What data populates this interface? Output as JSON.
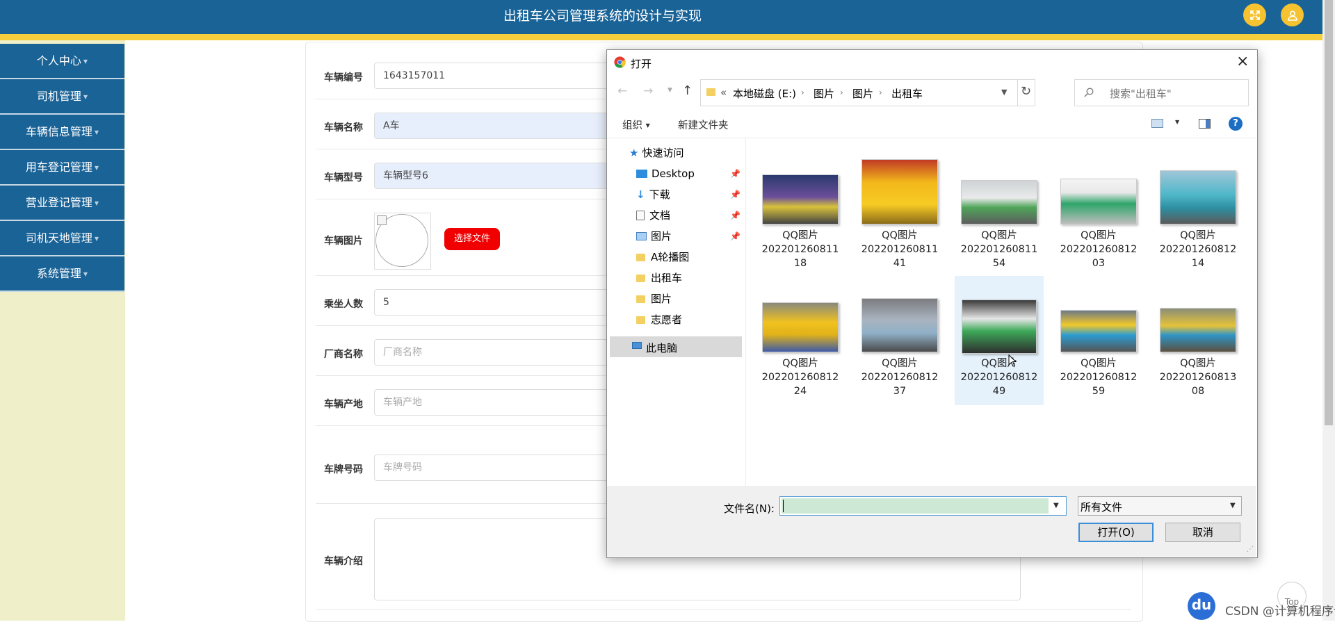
{
  "header": {
    "title": "出租车公司管理系统的设计与实现"
  },
  "sidebar": {
    "items": [
      {
        "label": "个人中心"
      },
      {
        "label": "司机管理"
      },
      {
        "label": "车辆信息管理"
      },
      {
        "label": "用车登记管理"
      },
      {
        "label": "营业登记管理"
      },
      {
        "label": "司机天地管理"
      },
      {
        "label": "系统管理"
      }
    ]
  },
  "form": {
    "vehicle_no": {
      "label": "车辆编号",
      "value": "1643157011"
    },
    "vehicle_name": {
      "label": "车辆名称",
      "value": "A车"
    },
    "vehicle_model": {
      "label": "车辆型号",
      "value": "车辆型号6"
    },
    "vehicle_image": {
      "label": "车辆图片",
      "button": "选择文件"
    },
    "passengers": {
      "label": "乘坐人数",
      "value": "5"
    },
    "manufacturer": {
      "label": "厂商名称",
      "placeholder": "厂商名称"
    },
    "origin": {
      "label": "车辆产地",
      "placeholder": "车辆产地"
    },
    "plate": {
      "label": "车牌号码",
      "placeholder": "车牌号码"
    },
    "intro": {
      "label": "车辆介绍"
    }
  },
  "dialog": {
    "title": "打开",
    "path": [
      "«",
      "本地磁盘 (E:)",
      "图片",
      "图片",
      "出租车"
    ],
    "search_placeholder": "搜索\"出租车\"",
    "toolbar": {
      "organize": "组织",
      "new_folder": "新建文件夹"
    },
    "nav": {
      "quick_access": "快速访问",
      "items": [
        "Desktop",
        "下载",
        "文档",
        "图片",
        "A轮播图",
        "出租车",
        "图片",
        "志愿者"
      ],
      "this_pc": "此电脑"
    },
    "files": [
      {
        "name1": "QQ图片",
        "name2": "202201260811",
        "name3": "18"
      },
      {
        "name1": "QQ图片",
        "name2": "202201260811",
        "name3": "41"
      },
      {
        "name1": "QQ图片",
        "name2": "202201260811",
        "name3": "54"
      },
      {
        "name1": "QQ图片",
        "name2": "202201260812",
        "name3": "03"
      },
      {
        "name1": "QQ图片",
        "name2": "202201260812",
        "name3": "14"
      },
      {
        "name1": "QQ图片",
        "name2": "202201260812",
        "name3": "24"
      },
      {
        "name1": "QQ图片",
        "name2": "202201260812",
        "name3": "37"
      },
      {
        "name1": "QQ图片",
        "name2": "202201260812",
        "name3": "49"
      },
      {
        "name1": "QQ图片",
        "name2": "202201260812",
        "name3": "59"
      },
      {
        "name1": "QQ图片",
        "name2": "202201260813",
        "name3": "08"
      }
    ],
    "filename_label": "文件名(N):",
    "filename_value": "",
    "filetype": "所有文件",
    "open_button": "打开(O)",
    "cancel_button": "取消"
  },
  "watermark": {
    "badge": "du",
    "text": "CSDN @计算机程序设计",
    "top": "Top"
  },
  "colors": {
    "header": "#1a6397",
    "accent_stripe": "#f6cd3c",
    "sidebar_bg": "#efefc9",
    "choose_button": "#f00000"
  }
}
